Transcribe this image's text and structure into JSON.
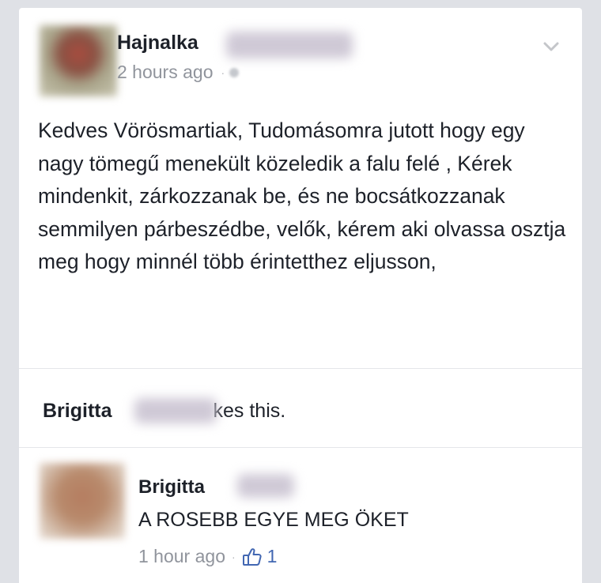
{
  "post": {
    "author_first_name": "Hajnalka",
    "timestamp": "2 hours ago",
    "separator": "·",
    "text": "Kedves Vörösmartiak, Tudomásomra jutott hogy egy nagy tömegű menekült közeledik a falu felé , Kérek mindenkit, zárkozzanak be, és ne bocsátkozzanak semmilyen párbeszédbe, velők, kérem aki olvassa osztja meg hogy minnél több érintetthez eljusson,"
  },
  "likes": {
    "liker_first_name": "Brigitta",
    "suffix": "kes this."
  },
  "comment": {
    "author_first_name": "Brigitta",
    "text": "A ROSEBB EGYE MEG ÖKET",
    "timestamp": "1 hour ago",
    "separator": "·",
    "like_count": "1"
  },
  "icons": {
    "privacy": "globe-icon",
    "menu": "chevron-down-icon",
    "comment_like": "thumbs-up-icon"
  },
  "colors": {
    "background": "#dfe1e6",
    "card": "#ffffff",
    "text": "#1d2129",
    "meta": "#90949c",
    "accent": "#4267b2"
  }
}
